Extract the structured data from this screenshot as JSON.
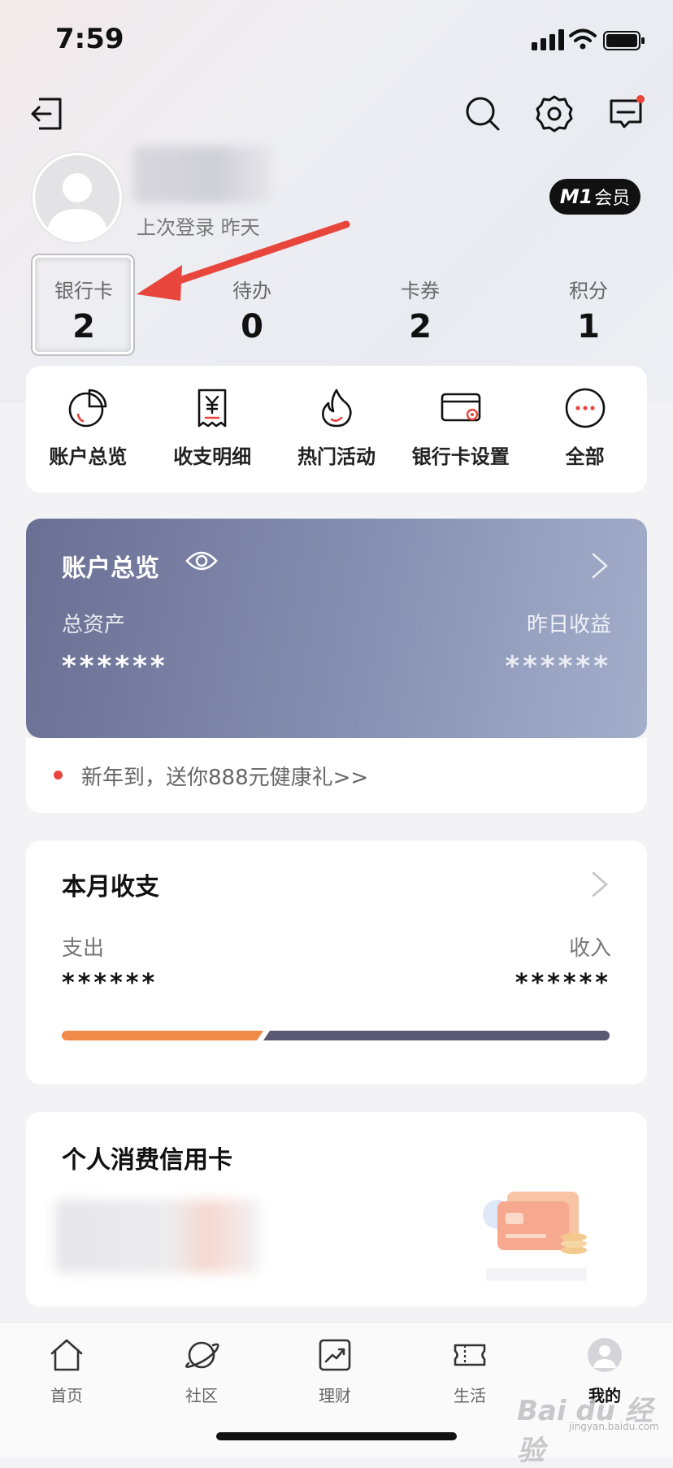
{
  "status_bar": {
    "time": "7:59"
  },
  "profile": {
    "last_login": "上次登录 昨天",
    "member_badge_prefix": "M1",
    "member_badge_label": "会员"
  },
  "stats": [
    {
      "label": "银行卡",
      "value": "2"
    },
    {
      "label": "待办",
      "value": "0"
    },
    {
      "label": "卡券",
      "value": "2"
    },
    {
      "label": "积分",
      "value": "1"
    }
  ],
  "quick_actions": [
    {
      "label": "账户总览",
      "icon": "pie-chart-icon"
    },
    {
      "label": "收支明细",
      "icon": "receipt-icon"
    },
    {
      "label": "热门活动",
      "icon": "flame-icon"
    },
    {
      "label": "银行卡设置",
      "icon": "card-settings-icon"
    },
    {
      "label": "全部",
      "icon": "more-icon"
    }
  ],
  "overview": {
    "title": "账户总览",
    "total_assets_label": "总资产",
    "yesterday_income_label": "昨日收益",
    "total_assets_value": "******",
    "yesterday_income_value": "******"
  },
  "promo": {
    "text": "新年到，送你888元健康礼>>"
  },
  "monthly": {
    "title": "本月收支",
    "expense_label": "支出",
    "income_label": "收入",
    "expense_value": "******",
    "income_value": "******"
  },
  "credit": {
    "title": "个人消费信用卡"
  },
  "tabbar": [
    {
      "label": "首页",
      "icon": "home-icon"
    },
    {
      "label": "社区",
      "icon": "planet-icon"
    },
    {
      "label": "理财",
      "icon": "chart-trend-icon"
    },
    {
      "label": "生活",
      "icon": "ticket-icon"
    },
    {
      "label": "我的",
      "icon": "avatar-icon",
      "active": true
    }
  ],
  "watermark": {
    "text": "Bai du 经验",
    "sub": "jingyan.baidu.com"
  },
  "colors": {
    "accent_red": "#e8453c",
    "overview_gradient_start": "#6a6f94",
    "overview_gradient_end": "#a3aecb",
    "bar_orange": "#f08a4b",
    "bar_dark": "#5a5872"
  }
}
